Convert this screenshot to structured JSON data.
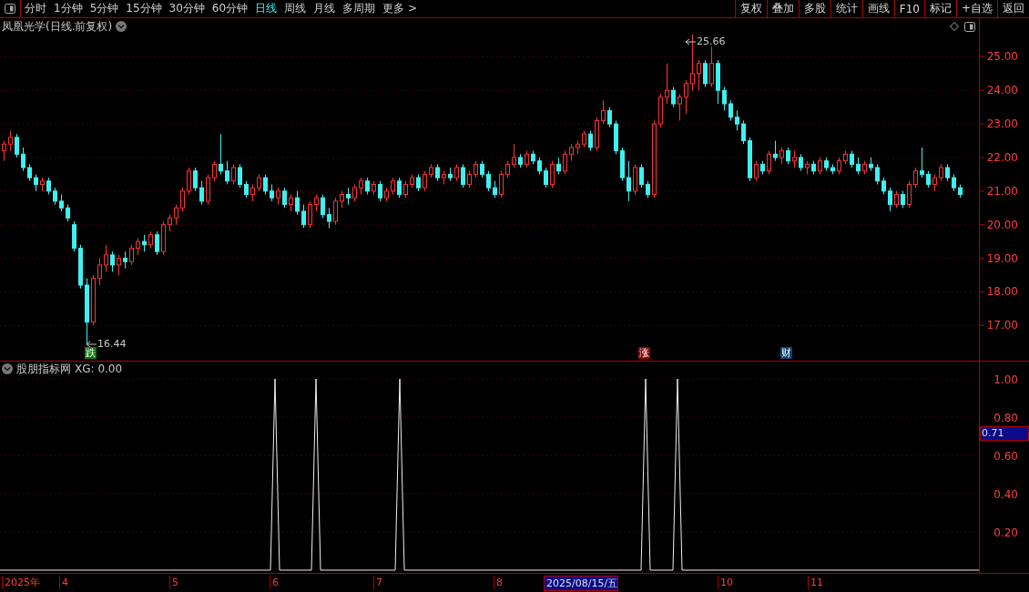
{
  "toolbar": {
    "periods": [
      {
        "label": "分时",
        "selected": false
      },
      {
        "label": "1分钟",
        "selected": false
      },
      {
        "label": "5分钟",
        "selected": false
      },
      {
        "label": "15分钟",
        "selected": false
      },
      {
        "label": "30分钟",
        "selected": false
      },
      {
        "label": "60分钟",
        "selected": false
      },
      {
        "label": "日线",
        "selected": true
      },
      {
        "label": "周线",
        "selected": false
      },
      {
        "label": "月线",
        "selected": false
      },
      {
        "label": "多周期",
        "selected": false
      }
    ],
    "more": "更多 >",
    "actions": [
      "复权",
      "叠加",
      "多股",
      "统计",
      "画线",
      "F10",
      "标记",
      "+自选",
      "返回"
    ]
  },
  "price_chart": {
    "title": "凤凰光学(日线.前复权)",
    "high_label": "25.66",
    "low_label": "16.44",
    "chart_data": {
      "type": "candlestick",
      "ylim": [
        9.55,
        26.23
      ],
      "grid": true,
      "yticks": [
        {
          "value": 25,
          "label": "25.00"
        },
        {
          "value": 24,
          "label": "24.00"
        },
        {
          "value": 23,
          "label": "23.00"
        },
        {
          "value": 22,
          "label": "22.00"
        },
        {
          "value": 21,
          "label": "21.00"
        },
        {
          "value": 20,
          "label": "20.00"
        },
        {
          "value": 19,
          "label": "19.00"
        },
        {
          "value": 18,
          "label": "18.00"
        },
        {
          "value": 17,
          "label": "17.00"
        }
      ],
      "ohlc": [
        [
          22.2,
          22.5,
          21.9,
          22.4
        ],
        [
          22.4,
          22.8,
          22.2,
          22.6
        ],
        [
          22.6,
          22.7,
          22.0,
          22.1
        ],
        [
          22.1,
          22.3,
          21.6,
          21.7
        ],
        [
          21.7,
          21.8,
          21.3,
          21.4
        ],
        [
          21.4,
          21.5,
          21.0,
          21.2
        ],
        [
          21.2,
          21.4,
          21.0,
          21.3
        ],
        [
          21.3,
          21.4,
          20.9,
          21.0
        ],
        [
          21.0,
          21.1,
          20.6,
          20.7
        ],
        [
          20.7,
          20.9,
          20.4,
          20.5
        ],
        [
          20.5,
          20.6,
          20.1,
          20.2
        ],
        [
          20.0,
          20.1,
          19.2,
          19.3
        ],
        [
          19.3,
          19.4,
          18.1,
          18.2
        ],
        [
          18.2,
          18.4,
          16.44,
          17.1
        ],
        [
          17.1,
          18.5,
          17.0,
          18.4
        ],
        [
          18.4,
          19.0,
          18.2,
          18.8
        ],
        [
          18.8,
          19.4,
          18.6,
          19.1
        ],
        [
          19.1,
          19.2,
          18.6,
          18.8
        ],
        [
          18.8,
          19.1,
          18.5,
          19.0
        ],
        [
          19.0,
          19.2,
          18.7,
          18.9
        ],
        [
          18.9,
          19.4,
          18.8,
          19.3
        ],
        [
          19.3,
          19.6,
          19.1,
          19.5
        ],
        [
          19.5,
          19.7,
          19.2,
          19.4
        ],
        [
          19.4,
          19.8,
          19.3,
          19.7
        ],
        [
          19.7,
          19.8,
          19.1,
          19.2
        ],
        [
          19.2,
          20.1,
          19.1,
          20.0
        ],
        [
          20.0,
          20.3,
          19.8,
          20.2
        ],
        [
          20.2,
          20.6,
          20.0,
          20.5
        ],
        [
          20.5,
          21.1,
          20.4,
          21.0
        ],
        [
          21.0,
          21.7,
          20.9,
          21.6
        ],
        [
          21.6,
          21.7,
          21.0,
          21.1
        ],
        [
          21.1,
          21.3,
          20.6,
          20.7
        ],
        [
          20.7,
          21.5,
          20.6,
          21.4
        ],
        [
          21.4,
          21.9,
          21.3,
          21.8
        ],
        [
          21.8,
          22.7,
          21.5,
          21.6
        ],
        [
          21.6,
          21.9,
          21.2,
          21.3
        ],
        [
          21.3,
          21.8,
          21.2,
          21.7
        ],
        [
          21.7,
          21.8,
          21.1,
          21.2
        ],
        [
          21.2,
          21.3,
          20.8,
          20.9
        ],
        [
          20.9,
          21.2,
          20.7,
          21.1
        ],
        [
          21.1,
          21.5,
          21.0,
          21.4
        ],
        [
          21.4,
          21.5,
          20.9,
          21.0
        ],
        [
          21.0,
          21.2,
          20.7,
          20.8
        ],
        [
          20.8,
          21.1,
          20.6,
          21.0
        ],
        [
          21.0,
          21.1,
          20.5,
          20.6
        ],
        [
          20.6,
          20.9,
          20.4,
          20.8
        ],
        [
          20.8,
          21.0,
          20.3,
          20.4
        ],
        [
          20.4,
          20.6,
          19.9,
          20.0
        ],
        [
          20.0,
          20.7,
          19.9,
          20.6
        ],
        [
          20.6,
          20.9,
          20.4,
          20.8
        ],
        [
          20.8,
          20.9,
          20.2,
          20.3
        ],
        [
          20.3,
          20.5,
          19.9,
          20.1
        ],
        [
          20.1,
          20.8,
          20.0,
          20.7
        ],
        [
          20.7,
          21.0,
          20.5,
          20.9
        ],
        [
          20.9,
          21.1,
          20.6,
          20.8
        ],
        [
          20.8,
          21.2,
          20.7,
          21.1
        ],
        [
          21.1,
          21.4,
          20.9,
          21.3
        ],
        [
          21.3,
          21.4,
          20.9,
          21.0
        ],
        [
          21.0,
          21.3,
          20.9,
          21.2
        ],
        [
          21.2,
          21.3,
          20.7,
          20.8
        ],
        [
          20.8,
          21.1,
          20.7,
          21.0
        ],
        [
          21.0,
          21.4,
          20.9,
          21.3
        ],
        [
          21.3,
          21.4,
          20.8,
          20.9
        ],
        [
          20.9,
          21.3,
          20.8,
          21.2
        ],
        [
          21.2,
          21.5,
          21.1,
          21.4
        ],
        [
          21.4,
          21.5,
          21.0,
          21.1
        ],
        [
          21.1,
          21.6,
          21.0,
          21.5
        ],
        [
          21.5,
          21.8,
          21.4,
          21.7
        ],
        [
          21.7,
          21.8,
          21.3,
          21.4
        ],
        [
          21.4,
          21.6,
          21.2,
          21.5
        ],
        [
          21.5,
          21.7,
          21.3,
          21.4
        ],
        [
          21.4,
          21.8,
          21.3,
          21.7
        ],
        [
          21.7,
          21.8,
          21.1,
          21.2
        ],
        [
          21.2,
          21.6,
          21.1,
          21.5
        ],
        [
          21.5,
          21.9,
          21.4,
          21.8
        ],
        [
          21.8,
          21.9,
          21.4,
          21.5
        ],
        [
          21.5,
          21.6,
          21.0,
          21.1
        ],
        [
          21.1,
          21.3,
          20.8,
          20.9
        ],
        [
          20.9,
          21.6,
          20.8,
          21.5
        ],
        [
          21.5,
          21.9,
          21.4,
          21.8
        ],
        [
          21.8,
          22.4,
          21.7,
          22.0
        ],
        [
          22.0,
          22.1,
          21.7,
          21.8
        ],
        [
          21.8,
          22.2,
          21.7,
          22.1
        ],
        [
          22.1,
          22.2,
          21.8,
          21.9
        ],
        [
          21.9,
          22.0,
          21.5,
          21.6
        ],
        [
          21.6,
          21.7,
          21.1,
          21.2
        ],
        [
          21.2,
          21.9,
          21.1,
          21.8
        ],
        [
          21.8,
          22.0,
          21.5,
          21.6
        ],
        [
          21.6,
          22.2,
          21.5,
          22.1
        ],
        [
          22.1,
          22.4,
          21.9,
          22.3
        ],
        [
          22.3,
          22.5,
          22.1,
          22.4
        ],
        [
          22.4,
          22.8,
          22.3,
          22.7
        ],
        [
          22.7,
          22.8,
          22.2,
          22.3
        ],
        [
          22.3,
          23.2,
          22.2,
          23.1
        ],
        [
          23.1,
          23.7,
          23.0,
          23.4
        ],
        [
          23.4,
          23.5,
          22.9,
          23.0
        ],
        [
          23.0,
          23.1,
          22.1,
          22.2
        ],
        [
          22.2,
          22.3,
          21.3,
          21.4
        ],
        [
          21.4,
          21.9,
          20.7,
          21.0
        ],
        [
          21.0,
          21.8,
          20.9,
          21.7
        ],
        [
          21.7,
          21.8,
          21.1,
          21.2
        ],
        [
          21.2,
          21.3,
          20.8,
          20.9
        ],
        [
          20.9,
          23.1,
          20.8,
          23.0
        ],
        [
          23.0,
          23.9,
          22.9,
          23.8
        ],
        [
          23.8,
          24.8,
          23.6,
          24.0
        ],
        [
          24.0,
          24.1,
          23.5,
          23.6
        ],
        [
          23.6,
          23.9,
          23.1,
          23.8
        ],
        [
          23.8,
          24.3,
          23.3,
          24.2
        ],
        [
          24.2,
          25.66,
          24.0,
          24.5
        ],
        [
          24.5,
          24.9,
          24.0,
          24.8
        ],
        [
          24.8,
          24.9,
          24.1,
          24.2
        ],
        [
          24.2,
          25.3,
          24.1,
          24.8
        ],
        [
          24.8,
          24.9,
          23.6,
          24.0
        ],
        [
          24.0,
          24.1,
          23.4,
          23.6
        ],
        [
          23.6,
          23.7,
          23.1,
          23.2
        ],
        [
          23.2,
          23.4,
          22.8,
          23.0
        ],
        [
          23.0,
          23.1,
          22.4,
          22.5
        ],
        [
          22.5,
          22.6,
          21.3,
          21.4
        ],
        [
          21.4,
          21.9,
          21.3,
          21.8
        ],
        [
          21.8,
          21.9,
          21.5,
          21.6
        ],
        [
          21.6,
          22.2,
          21.5,
          22.1
        ],
        [
          22.1,
          22.5,
          21.9,
          22.0
        ],
        [
          22.0,
          22.3,
          21.8,
          22.2
        ],
        [
          22.2,
          22.3,
          21.8,
          21.9
        ],
        [
          21.9,
          22.2,
          21.7,
          22.0
        ],
        [
          22.0,
          22.1,
          21.6,
          21.7
        ],
        [
          21.7,
          21.9,
          21.5,
          21.8
        ],
        [
          21.8,
          21.9,
          21.5,
          21.6
        ],
        [
          21.6,
          22.0,
          21.5,
          21.9
        ],
        [
          21.9,
          22.0,
          21.6,
          21.7
        ],
        [
          21.7,
          21.8,
          21.5,
          21.6
        ],
        [
          21.6,
          22.0,
          21.5,
          21.9
        ],
        [
          21.9,
          22.2,
          21.8,
          22.1
        ],
        [
          22.1,
          22.2,
          21.7,
          21.8
        ],
        [
          21.8,
          22.0,
          21.5,
          21.6
        ],
        [
          21.6,
          21.9,
          21.5,
          21.8
        ],
        [
          21.8,
          22.0,
          21.6,
          21.7
        ],
        [
          21.7,
          21.8,
          21.2,
          21.3
        ],
        [
          21.3,
          21.4,
          20.9,
          21.0
        ],
        [
          21.0,
          21.1,
          20.4,
          20.6
        ],
        [
          20.6,
          21.0,
          20.5,
          20.9
        ],
        [
          20.9,
          21.0,
          20.5,
          20.6
        ],
        [
          20.6,
          21.3,
          20.5,
          21.2
        ],
        [
          21.2,
          21.7,
          21.1,
          21.6
        ],
        [
          21.6,
          22.3,
          21.4,
          21.5
        ],
        [
          21.5,
          21.6,
          21.1,
          21.2
        ],
        [
          21.2,
          21.5,
          21.0,
          21.4
        ],
        [
          21.4,
          21.8,
          21.3,
          21.7
        ],
        [
          21.7,
          21.8,
          21.3,
          21.4
        ],
        [
          21.4,
          21.5,
          21.0,
          21.1
        ],
        [
          21.1,
          21.2,
          20.8,
          20.9
        ]
      ]
    },
    "signals": [
      {
        "text": "跌",
        "kind": "down"
      },
      {
        "text": "涨",
        "kind": "up"
      },
      {
        "text": "财",
        "kind": "finance"
      }
    ]
  },
  "indicator": {
    "title": "股朋指标网",
    "reading": "XG: 0.00",
    "axis_labels": [
      "1.00",
      "0.80",
      "0.60",
      "0.40",
      "0.20"
    ],
    "cursor_value": "0.71"
  },
  "date_axis": [
    {
      "label": "2025年",
      "selected": false
    },
    {
      "label": "4",
      "selected": false
    },
    {
      "label": "5",
      "selected": false
    },
    {
      "label": "6",
      "selected": false
    },
    {
      "label": "7",
      "selected": false
    },
    {
      "label": "8",
      "selected": false
    },
    {
      "label": "2025/08/15/五",
      "selected": true
    },
    {
      "label": "10",
      "selected": false
    },
    {
      "label": "11",
      "selected": false
    }
  ]
}
